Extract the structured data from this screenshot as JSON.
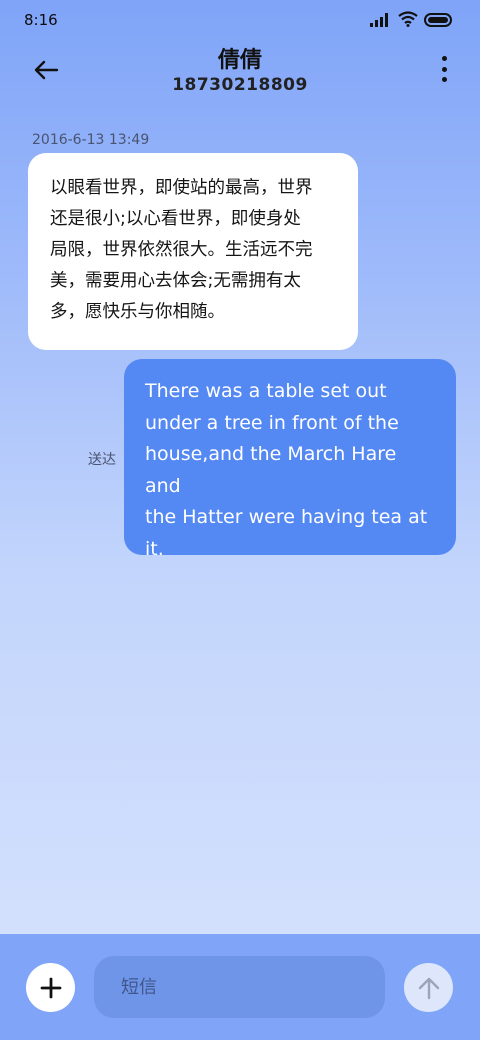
{
  "status_bar": {
    "time": "8:16",
    "icons": [
      "signal-icon",
      "wifi-icon",
      "battery-icon"
    ]
  },
  "header": {
    "back_icon": "arrow-left-icon",
    "contact_name": "倩倩",
    "contact_number": "18730218809",
    "more_icon": "more-vertical-icon"
  },
  "messages": [
    {
      "direction": "incoming",
      "timestamp": "2016-6-13 13:49",
      "lines": [
        "以眼看世界，即使站的最高，世界",
        "还是很小;以心看世界，即使身处",
        "局限，世界依然很大。生活远不完",
        "美，需要用心去体会;无需拥有太",
        "多，愿快乐与你相随。"
      ]
    },
    {
      "direction": "outgoing",
      "status": "送达",
      "lines": [
        "There was a table set out",
        "under a tree in front of the",
        "house,and the March Hare and",
        "the Hatter were having tea at",
        "it."
      ]
    }
  ],
  "input_bar": {
    "add_icon": "plus-icon",
    "placeholder": "短信",
    "send_icon": "arrow-up-icon"
  },
  "colors": {
    "accent": "#5488f3",
    "incoming_bubble": "#ffffff",
    "input_bar_bg": "#7fa4f8"
  }
}
